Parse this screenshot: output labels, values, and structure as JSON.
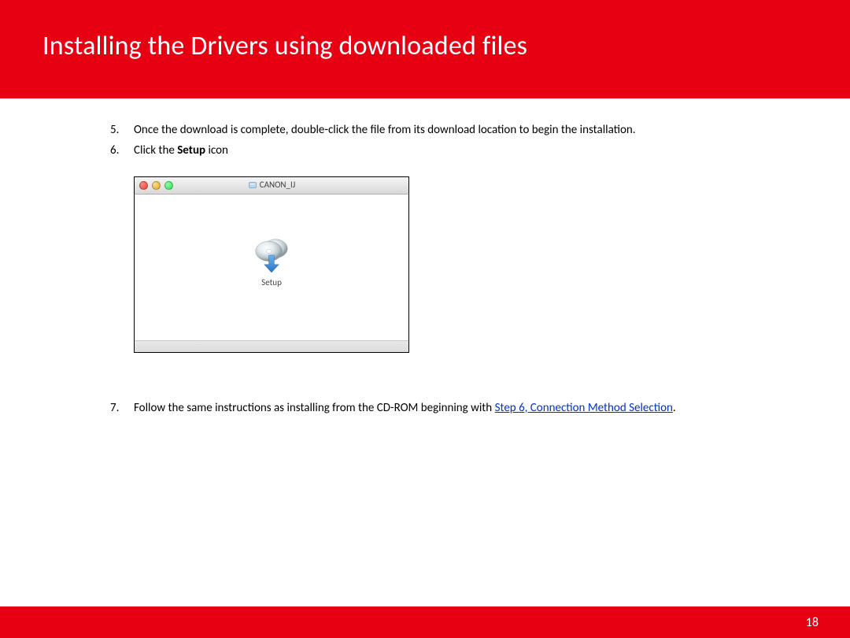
{
  "header": {
    "title": "Installing  the Drivers using downloaded files"
  },
  "steps": {
    "five": {
      "num": "5.",
      "text": "Once the download is complete, double-click the file from its download location to begin the installation."
    },
    "six": {
      "num": "6.",
      "text_before": "Click the ",
      "bold": "Setup",
      "text_after": " icon"
    },
    "seven": {
      "num": "7.",
      "text_before": "Follow the same instructions as installing from  the CD-ROM beginning with ",
      "link": "Step 6, Connection Method Selection",
      "text_after": "."
    }
  },
  "screenshot": {
    "window_title": "CANON_IJ",
    "icon_label": "Setup"
  },
  "footer": {
    "page": "18"
  }
}
